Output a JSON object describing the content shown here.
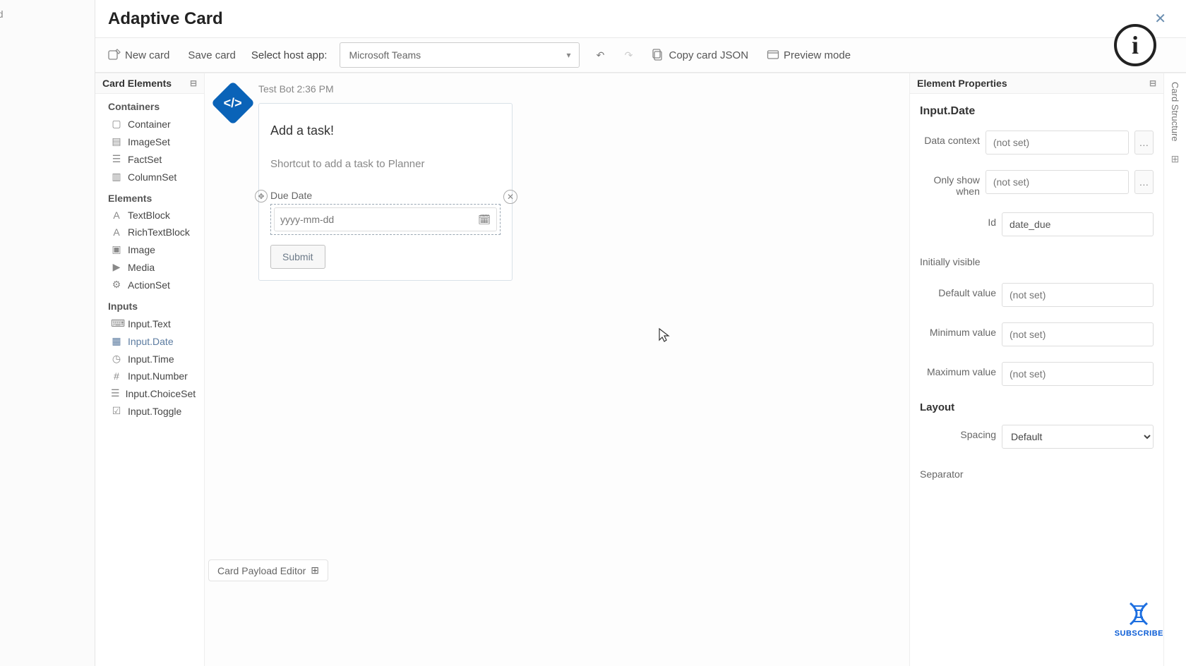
{
  "outer_tab": "tled",
  "header": {
    "title": "Adaptive Card"
  },
  "toolbar": {
    "new_card": "New card",
    "save_card": "Save card",
    "host_label": "Select host app:",
    "host_value": "Microsoft Teams",
    "copy_json": "Copy card JSON",
    "preview": "Preview mode"
  },
  "elements_panel": {
    "title": "Card Elements",
    "categories": [
      {
        "label": "Containers",
        "items": [
          {
            "name": "Container",
            "icon": "▢"
          },
          {
            "name": "ImageSet",
            "icon": "▤"
          },
          {
            "name": "FactSet",
            "icon": "☰"
          },
          {
            "name": "ColumnSet",
            "icon": "▥"
          }
        ]
      },
      {
        "label": "Elements",
        "items": [
          {
            "name": "TextBlock",
            "icon": "A"
          },
          {
            "name": "RichTextBlock",
            "icon": "A"
          },
          {
            "name": "Image",
            "icon": "▣"
          },
          {
            "name": "Media",
            "icon": "▶"
          },
          {
            "name": "ActionSet",
            "icon": "⚙"
          }
        ]
      },
      {
        "label": "Inputs",
        "items": [
          {
            "name": "Input.Text",
            "icon": "⌨"
          },
          {
            "name": "Input.Date",
            "icon": "▦",
            "active": true
          },
          {
            "name": "Input.Time",
            "icon": "◷"
          },
          {
            "name": "Input.Number",
            "icon": "#"
          },
          {
            "name": "Input.ChoiceSet",
            "icon": "☰"
          },
          {
            "name": "Input.Toggle",
            "icon": "☑"
          }
        ]
      }
    ]
  },
  "canvas": {
    "bot_line": "Test Bot 2:36 PM",
    "card_title": "Add a task!",
    "card_desc": "Shortcut to add a task to Planner",
    "due_label": "Due Date",
    "date_placeholder": "yyyy-mm-dd",
    "submit": "Submit",
    "payload_editor": "Card Payload Editor"
  },
  "properties": {
    "panel_title": "Element Properties",
    "element_type": "Input.Date",
    "notset": "(not set)",
    "labels": {
      "data_context": "Data context",
      "only_show_when": "Only show when",
      "id": "Id",
      "initially_visible": "Initially visible",
      "default_value": "Default value",
      "min_value": "Minimum value",
      "max_value": "Maximum value",
      "layout": "Layout",
      "spacing": "Spacing",
      "separator": "Separator"
    },
    "id_value": "date_due",
    "spacing_value": "Default"
  },
  "right_rail": {
    "label": "Card Structure"
  },
  "subscribe": {
    "label": "SUBSCRIBE"
  }
}
